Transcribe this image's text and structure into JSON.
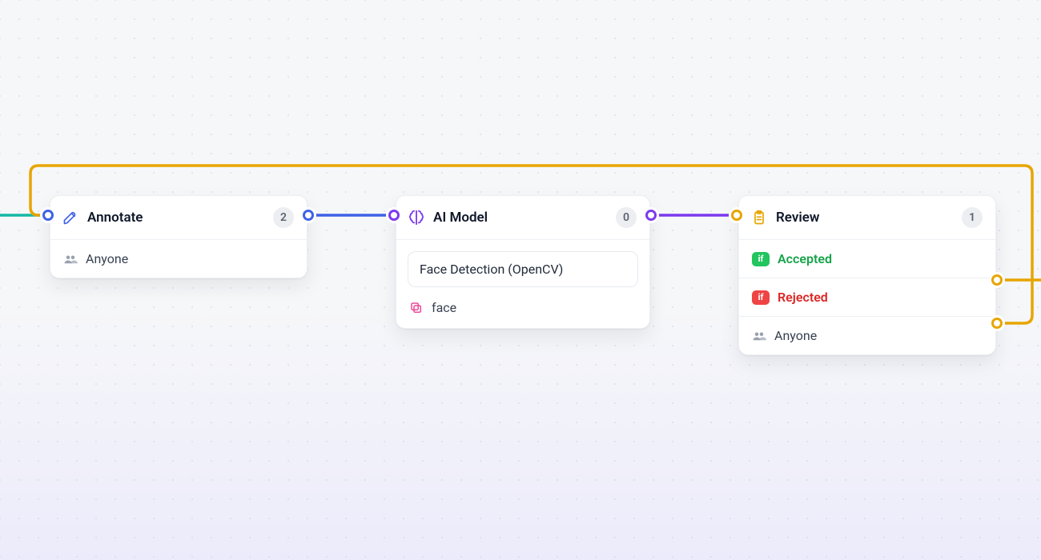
{
  "colors": {
    "teal": "#14b8a6",
    "blue": "#3f62e6",
    "purple": "#7c3aed",
    "amber": "#e7a500",
    "pink": "#ec4899",
    "green_ok": "#16a34a",
    "red_err": "#dc2626",
    "muted": "#6b7280"
  },
  "nodes": {
    "annotate": {
      "title": "Annotate",
      "count": "2",
      "assignee": "Anyone",
      "icon": "pencil-icon"
    },
    "ai_model": {
      "title": "AI Model",
      "count": "0",
      "model_name": "Face Detection (OpenCV)",
      "label_name": "face",
      "icon": "brain-icon",
      "label_icon": "copy-icon"
    },
    "review": {
      "title": "Review",
      "count": "1",
      "accepted_label": "Accepted",
      "rejected_label": "Rejected",
      "assignee": "Anyone",
      "icon": "clipboard-icon",
      "if_label": "if"
    }
  }
}
